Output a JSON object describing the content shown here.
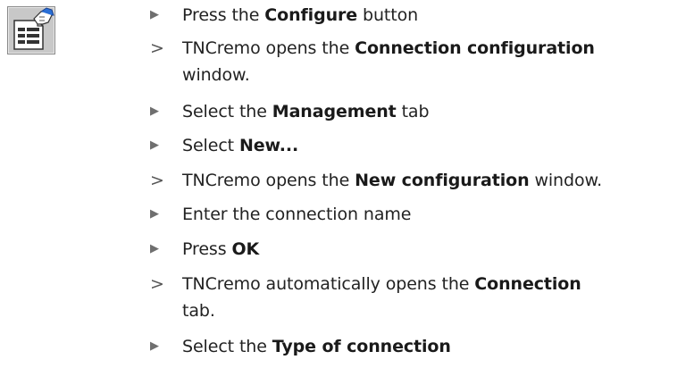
{
  "icon": {
    "name": "configure-icon"
  },
  "markers": {
    "action": "▶",
    "result": ">"
  },
  "steps": [
    {
      "kind": "action",
      "pre": "Press the ",
      "bold": "Configure",
      "post": " button",
      "cont": ""
    },
    {
      "kind": "result",
      "pre": "TNCremo opens the ",
      "bold": "Connection configuration",
      "post": "",
      "cont": "window."
    },
    {
      "kind": "action",
      "pre": "Select the ",
      "bold": "Management",
      "post": " tab",
      "cont": ""
    },
    {
      "kind": "action",
      "pre": "Select ",
      "bold": "New...",
      "post": "",
      "cont": ""
    },
    {
      "kind": "result",
      "pre": "TNCremo opens the ",
      "bold": "New configuration",
      "post": " window.",
      "cont": ""
    },
    {
      "kind": "action",
      "pre": "Enter the connection name",
      "bold": "",
      "post": "",
      "cont": ""
    },
    {
      "kind": "action",
      "pre": "Press ",
      "bold": "OK",
      "post": "",
      "cont": ""
    },
    {
      "kind": "result",
      "pre": "TNCremo automatically opens the ",
      "bold": "Connection",
      "post": "",
      "cont": "tab."
    },
    {
      "kind": "action",
      "pre": "Select the ",
      "bold": "Type of connection",
      "post": "",
      "cont": ""
    }
  ]
}
